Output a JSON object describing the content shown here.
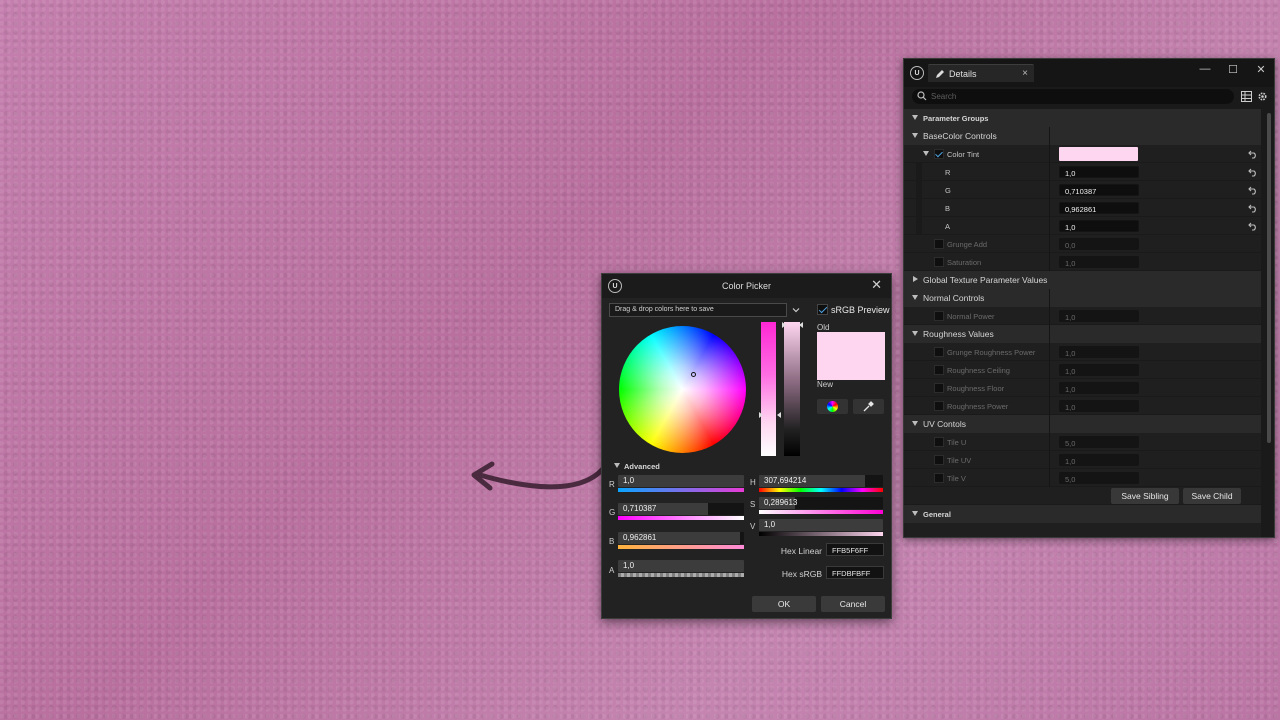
{
  "details": {
    "tab_label": "Details",
    "search_placeholder": "Search",
    "win_min": "—",
    "win_max": "☐",
    "win_close": "✕",
    "tab_close": "×",
    "rows": {
      "parameter_groups": "Parameter Groups",
      "basecolor_controls": "BaseColor Controls",
      "color_tint": "Color Tint",
      "r_label": "R",
      "r_value": "1,0",
      "g_label": "G",
      "g_value": "0,710387",
      "b_label": "B",
      "b_value": "0,962861",
      "a_label": "A",
      "a_value": "1,0",
      "grunge_add": "Grunge Add",
      "grunge_add_value": "0,0",
      "saturation": "Saturation",
      "saturation_value": "1,0",
      "global_texture": "Global Texture Parameter Values",
      "normal_controls": "Normal Controls",
      "normal_power": "Normal Power",
      "normal_power_value": "1,0",
      "roughness_values": "Roughness Values",
      "grunge_roughness_power": "Grunge Roughness Power",
      "grunge_roughness_power_value": "1,0",
      "roughness_ceiling": "Roughness Ceiling",
      "roughness_ceiling_value": "1,0",
      "roughness_floor": "Roughness Floor",
      "roughness_floor_value": "1,0",
      "roughness_power": "Roughness Power",
      "roughness_power_value": "1,0",
      "uv_controls": "UV Contols",
      "tile_u": "Tile U",
      "tile_u_value": "5,0",
      "tile_uv": "Tile UV",
      "tile_uv_value": "1,0",
      "tile_v": "Tile V",
      "tile_v_value": "5,0",
      "general": "General"
    },
    "save_sibling": "Save Sibling",
    "save_child": "Save Child",
    "tint_color": "#ffd6f0"
  },
  "picker": {
    "title": "Color Picker",
    "close": "✕",
    "drag_hint": "Drag & drop colors here to save",
    "srgb_preview": "sRGB Preview",
    "old_label": "Old",
    "new_label": "New",
    "advanced": "Advanced",
    "channels": {
      "r_label": "R",
      "r_value": "1,0",
      "g_label": "G",
      "g_value": "0,710387",
      "b_label": "B",
      "b_value": "0,962861",
      "a_label": "A",
      "a_value": "1,0",
      "h_label": "H",
      "h_value": "307,694214",
      "s_label": "S",
      "s_value": "0,289613",
      "v_label": "V",
      "v_value": "1,0"
    },
    "hex_linear_label": "Hex Linear",
    "hex_linear_value": "FFB5F6FF",
    "hex_srgb_label": "Hex sRGB",
    "hex_srgb_value": "FFDBFBFF",
    "ok": "OK",
    "cancel": "Cancel",
    "old_color": "#ffd6f0"
  }
}
